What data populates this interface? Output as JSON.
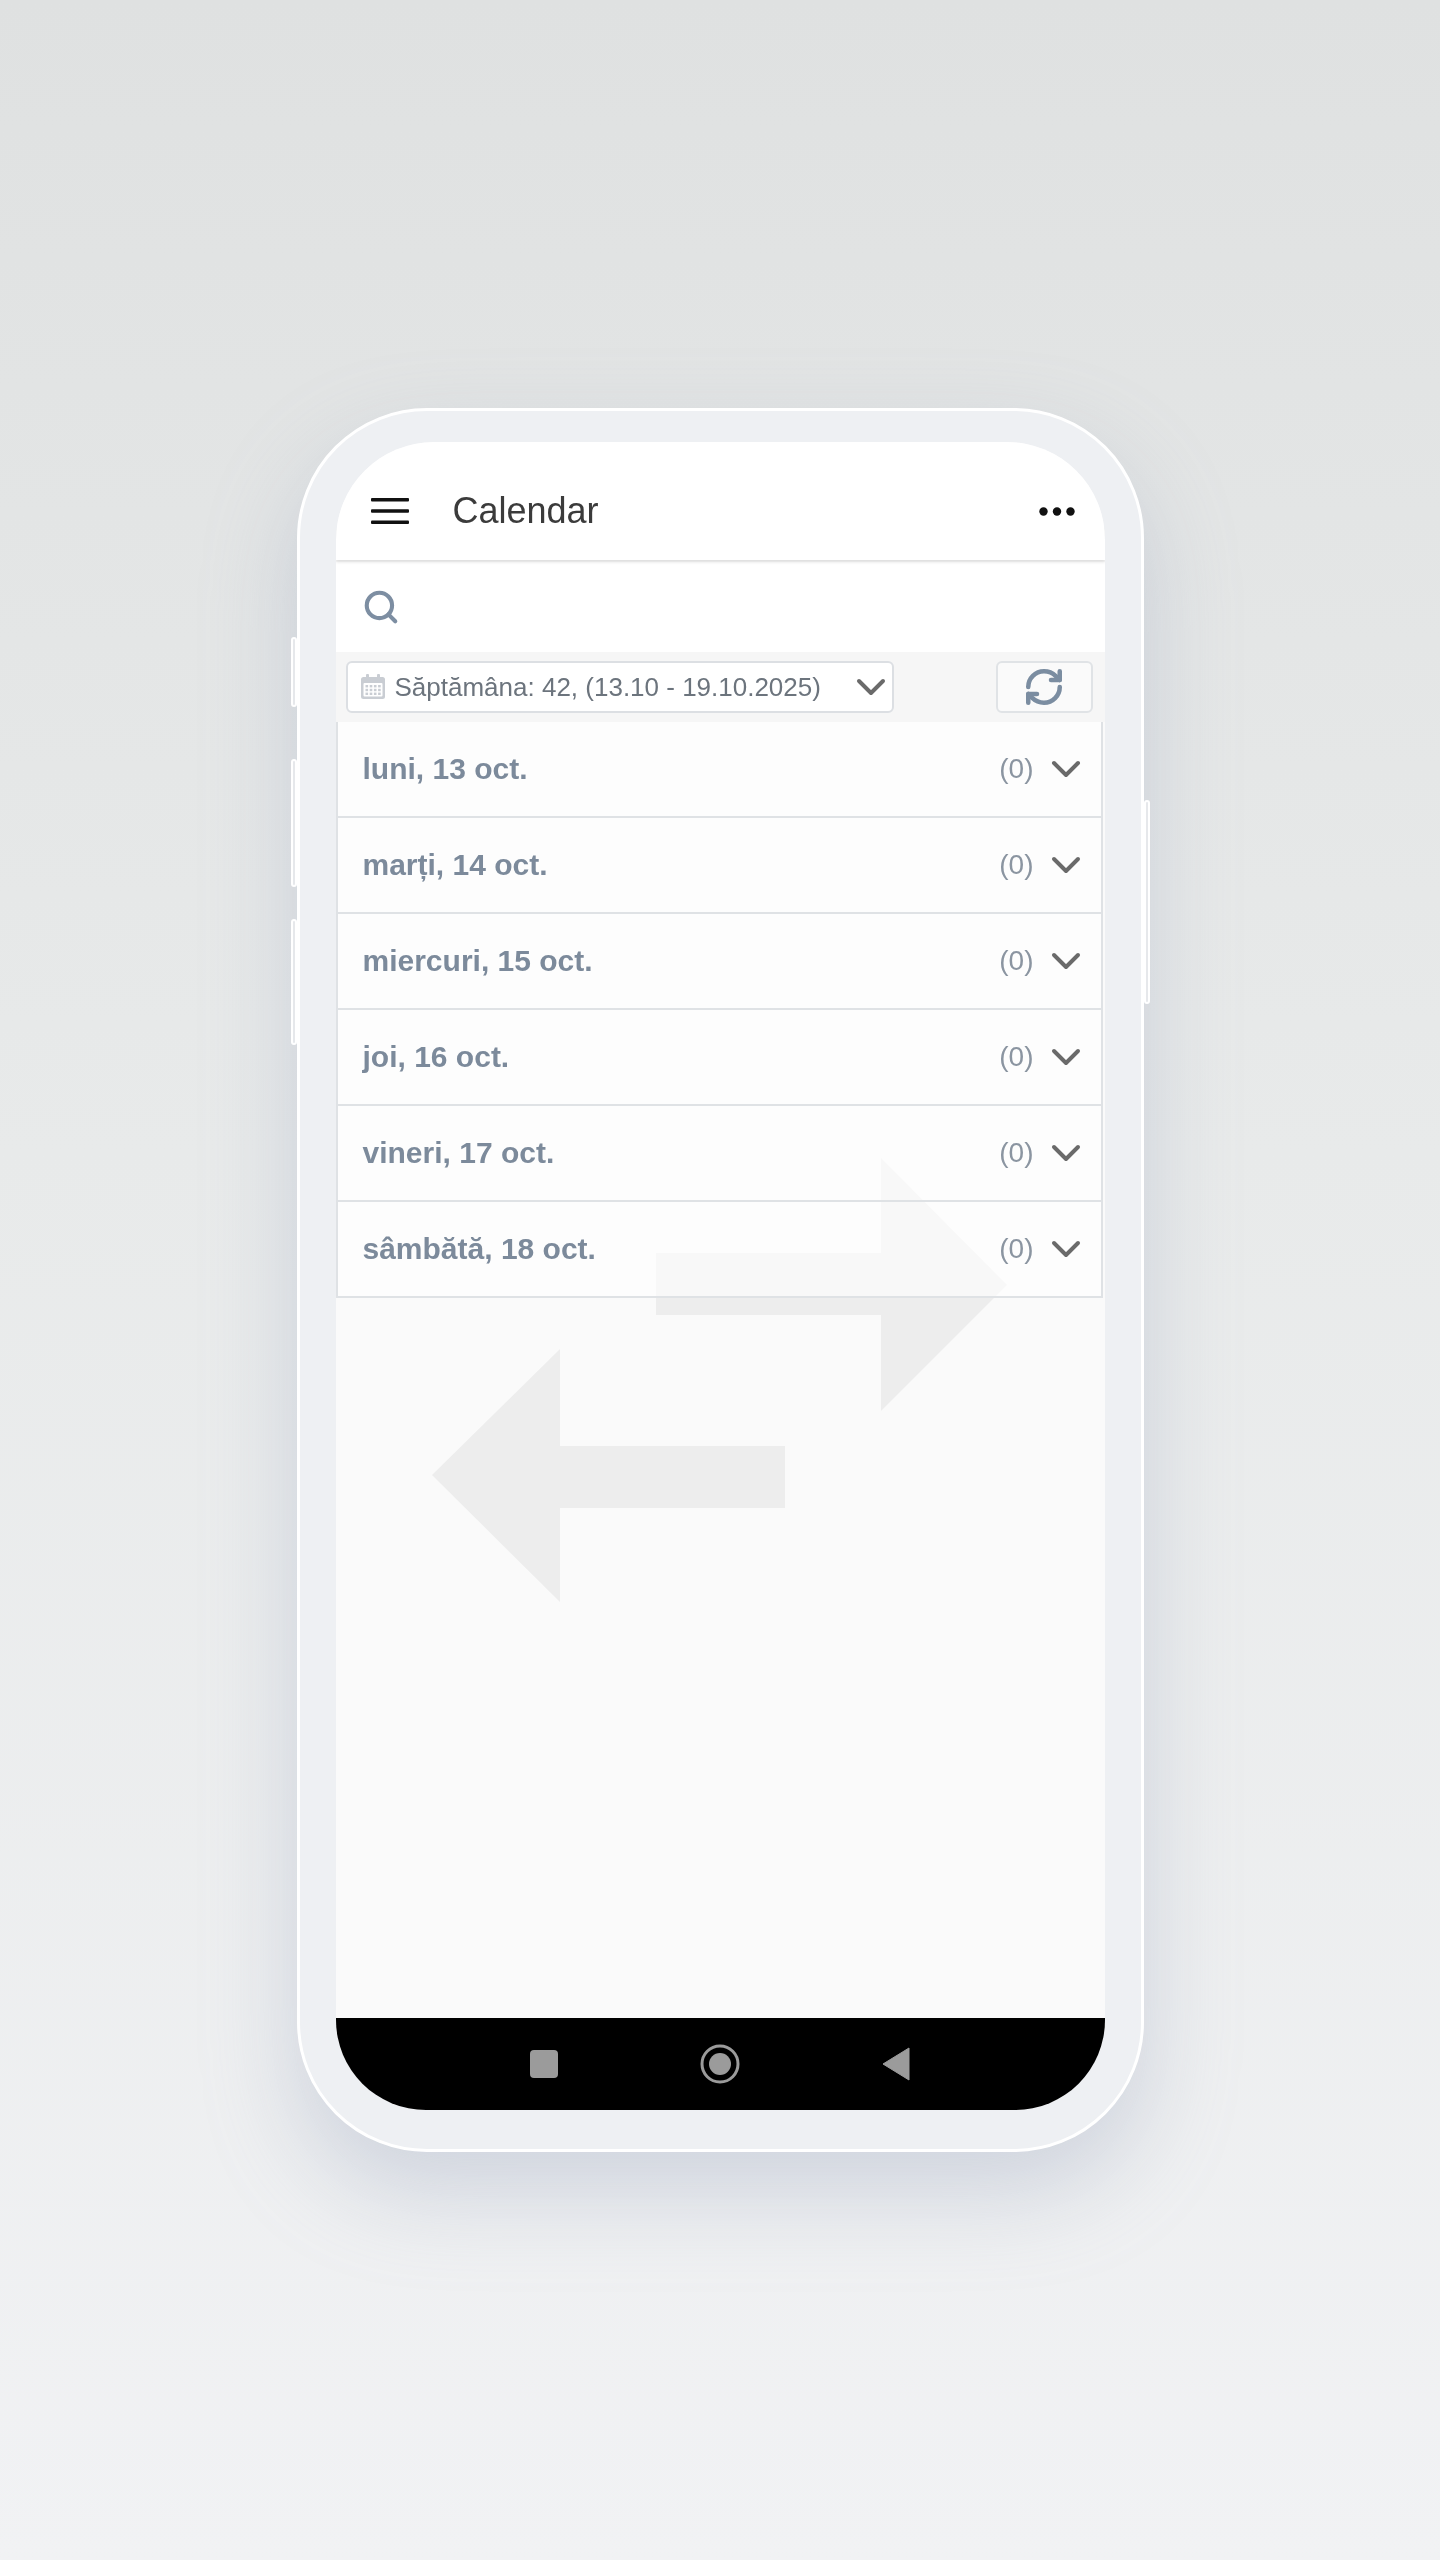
{
  "app_bar": {
    "title": "Calendar"
  },
  "week_selector": {
    "label": "Săptămâna: 42, (13.10 - 19.10.2025)"
  },
  "days": [
    {
      "label": "luni, 13 oct.",
      "count": "(0)",
      "expanded": false
    },
    {
      "label": "marți, 14 oct.",
      "count": "(0)",
      "expanded": false
    },
    {
      "label": "miercuri, 15 oct.",
      "count": "(0)",
      "expanded": false
    },
    {
      "label": "joi, 16 oct.",
      "count": "(0)",
      "expanded": false
    },
    {
      "label": "vineri, 17 oct.",
      "count": "(0)",
      "expanded": false
    },
    {
      "label": "sâmbătă, 18 oct.",
      "count": "(0)",
      "expanded": false
    }
  ]
}
